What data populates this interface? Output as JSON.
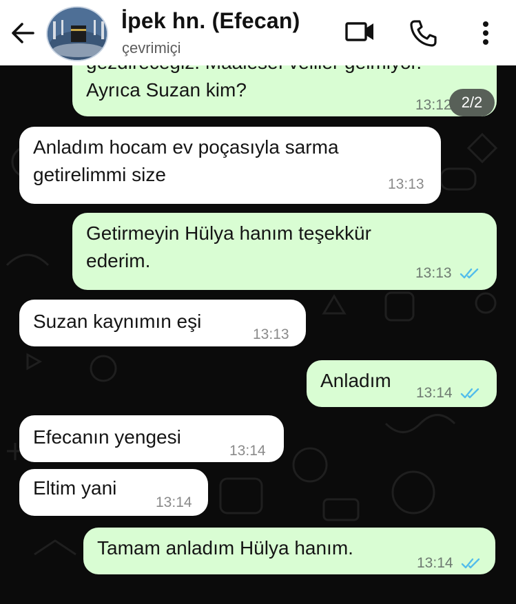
{
  "header": {
    "contact_name": "İpek hn. (Efecan)",
    "status": "çevrimiçi",
    "icons": [
      "back-arrow-icon",
      "video-call-icon",
      "phone-icon",
      "more-vert-icon"
    ]
  },
  "colors": {
    "outgoing_bubble": "#d9fdd3",
    "incoming_bubble": "#ffffff",
    "chat_background": "#0b0b0b",
    "read_tick": "#53bdeb"
  },
  "page_indicator": "2/2",
  "messages": [
    {
      "direction": "out",
      "lines": [
        "gezdireceğiz. Maalesef veliler gelmiyor.",
        "Ayrıca Suzan kim?"
      ],
      "time": "13:12",
      "read": true
    },
    {
      "direction": "in",
      "lines": [
        "Anladım hocam ev poçasıyla sarma",
        "getirelimmi size"
      ],
      "time": "13:13"
    },
    {
      "direction": "out",
      "lines": [
        "Getirmeyin Hülya hanım teşekkür",
        "ederim."
      ],
      "time": "13:13",
      "read": true
    },
    {
      "direction": "in",
      "lines": [
        "Suzan kaynımın eşi"
      ],
      "time": "13:13"
    },
    {
      "direction": "out",
      "lines": [
        "Anladım"
      ],
      "time": "13:14",
      "read": true
    },
    {
      "direction": "in",
      "lines": [
        "Efecanın yengesi"
      ],
      "time": "13:14"
    },
    {
      "direction": "in",
      "lines": [
        "Eltim yani"
      ],
      "time": "13:14"
    },
    {
      "direction": "out",
      "lines": [
        "Tamam anladım Hülya hanım."
      ],
      "time": "13:14",
      "read": true
    }
  ]
}
